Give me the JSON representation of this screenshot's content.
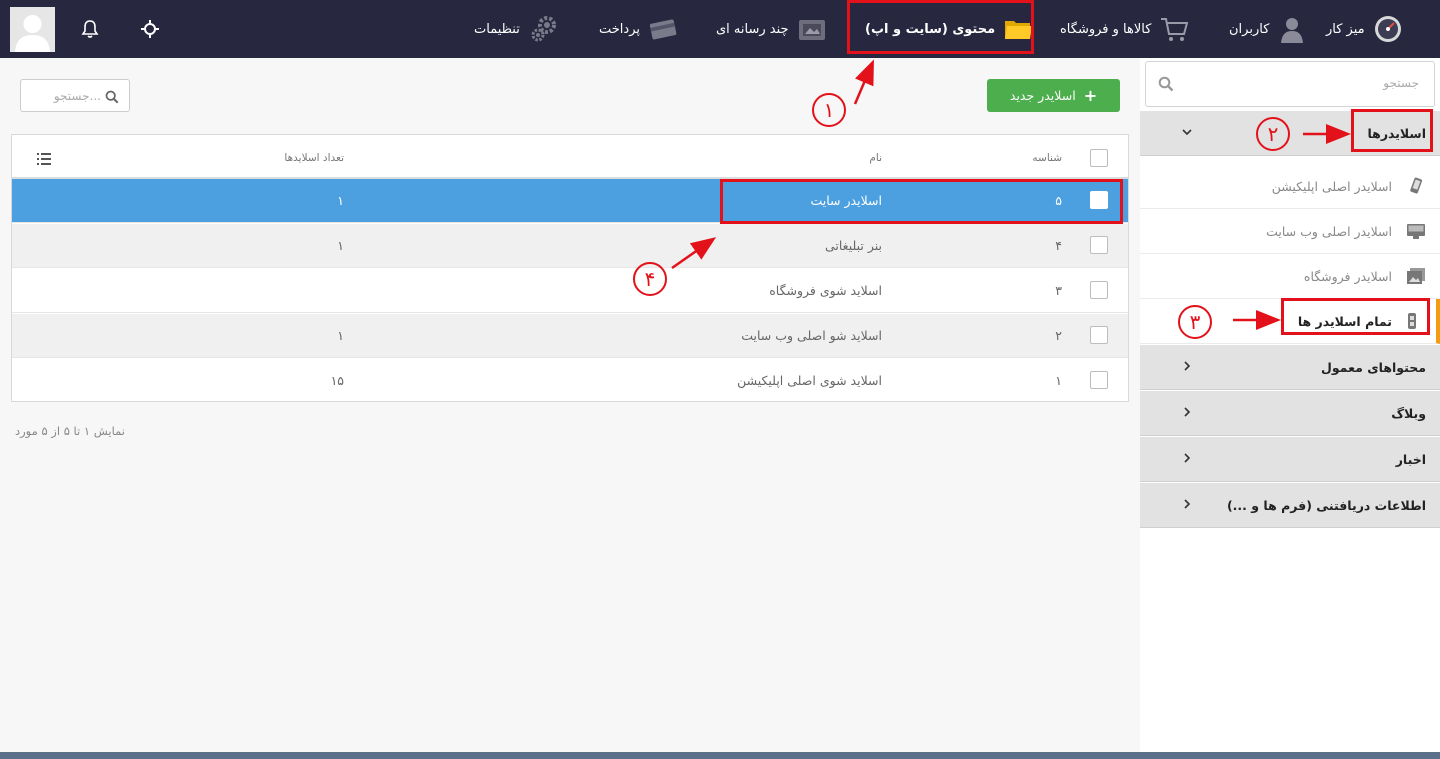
{
  "topbar": {
    "nav": [
      {
        "label": "میز کار",
        "icon": "dashboard-gauge-icon"
      },
      {
        "label": "کاربران",
        "icon": "user-icon"
      },
      {
        "label": "کالاها و فروشگاه",
        "icon": "cart-icon"
      },
      {
        "label": "محتوی (سایت و اپ)",
        "icon": "folder-icon"
      },
      {
        "label": "چند رسانه ای",
        "icon": "media-icon"
      },
      {
        "label": "پرداخت",
        "icon": "credit-card-icon"
      },
      {
        "label": "تنظیمات",
        "icon": "gears-icon"
      }
    ]
  },
  "sidebar": {
    "search_placeholder": "جستجو",
    "sliders_section": "اسلایدرها",
    "sub_items": [
      {
        "label": "اسلایدر اصلی اپلیکیشن",
        "icon": "mobile-icon"
      },
      {
        "label": "اسلایدر اصلی وب سایت",
        "icon": "monitor-icon"
      },
      {
        "label": "اسلایدر فروشگاه",
        "icon": "image-icon"
      },
      {
        "label": "تمام اسلایدر ها",
        "icon": "sliders-icon"
      }
    ],
    "sections": [
      "محتواهای معمول",
      "وبلاگ",
      "اخبار",
      "اطلاعات دریافتنی (فرم ها و ...)"
    ]
  },
  "content": {
    "new_button": "اسلایدر جدید",
    "filter_placeholder": "جستجو...",
    "headers": {
      "id": "شناسه",
      "name": "نام",
      "count": "تعداد اسلایدها"
    },
    "rows": [
      {
        "id": "۵",
        "name": "اسلایدر سایت",
        "count": "۱"
      },
      {
        "id": "۴",
        "name": "بنر تبلیغاتی",
        "count": "۱"
      },
      {
        "id": "۳",
        "name": "اسلاید شوی فروشگاه",
        "count": ""
      },
      {
        "id": "۲",
        "name": "اسلاید شو اصلی وب سایت",
        "count": "۱"
      },
      {
        "id": "۱",
        "name": "اسلاید شوی اصلی اپلیکیشن",
        "count": "۱۵"
      }
    ],
    "footer": "نمایش ۱ تا ۵ از ۵ مورد"
  },
  "annotations": [
    "۱",
    "۲",
    "۳",
    "۴"
  ],
  "colors": {
    "topbar": "#27273f",
    "selected_row": "#4da0df",
    "new_button": "#4cae4c",
    "annotation": "#e3121a",
    "active_marker": "#f39c12"
  }
}
